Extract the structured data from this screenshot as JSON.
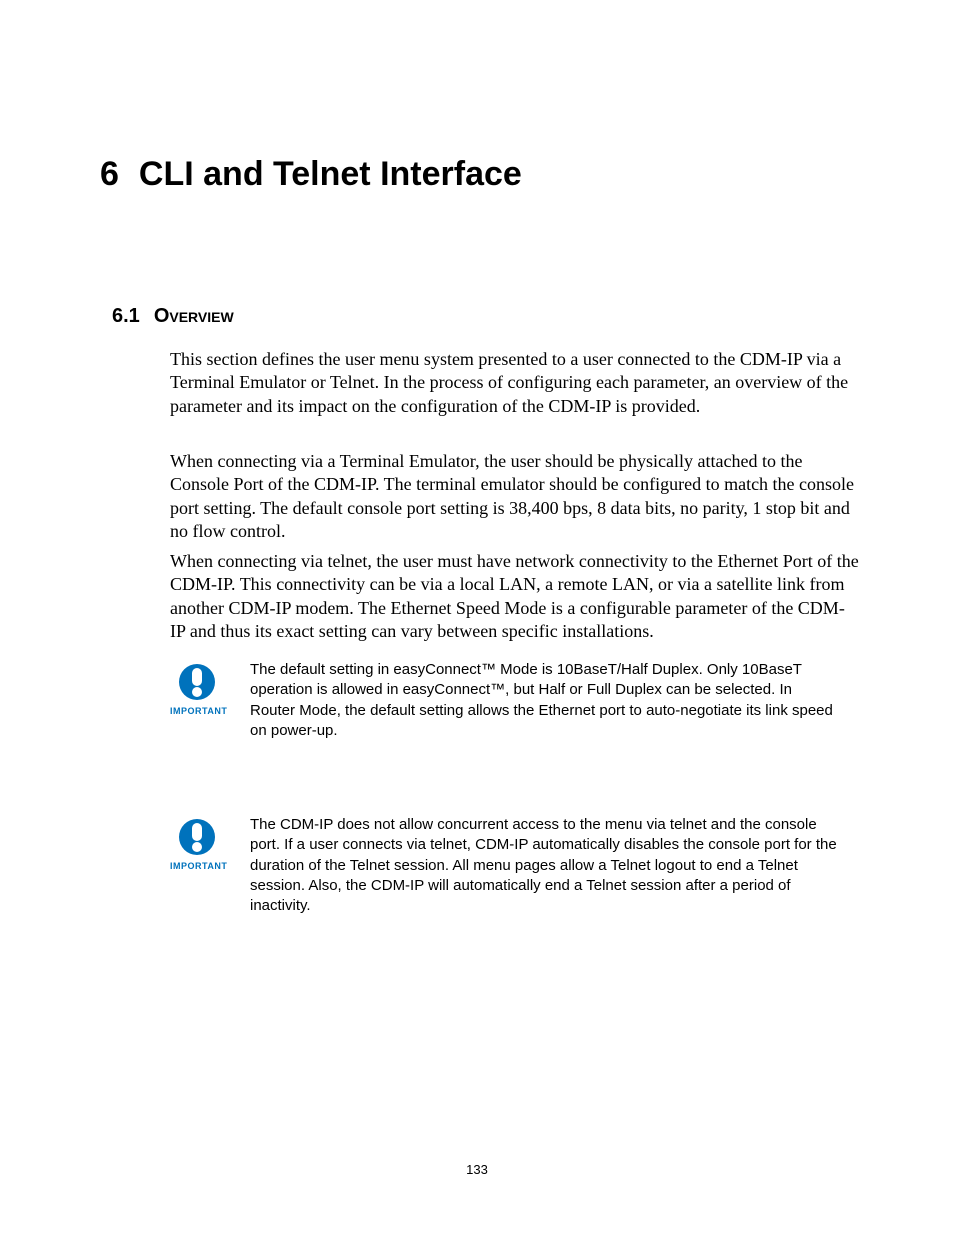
{
  "chapter": {
    "number": "6",
    "title": "CLI and Telnet Interface"
  },
  "section": {
    "number": "6.1",
    "title": "Overview"
  },
  "paragraphs": {
    "p1": "This section defines the user menu system presented to a user connected to the CDM-IP via a Terminal Emulator or Telnet. In the process of configuring each parameter, an overview of the parameter and its impact on the configuration of the CDM-IP is provided.",
    "p2": "When connecting via a Terminal Emulator, the user should be physically attached to the Console Port of the CDM-IP. The terminal emulator should be configured to match the console port setting. The default console port setting is 38,400 bps, 8 data bits, no parity, 1 stop bit and no flow control.",
    "p3": "When connecting via telnet, the user must have network connectivity to the Ethernet Port of the CDM-IP. This connectivity can be via a local LAN, a remote LAN, or via a satellite link from another CDM-IP modem. The Ethernet Speed Mode is a configurable parameter of the CDM-IP and thus its exact setting can vary between specific installations."
  },
  "important": {
    "label": "IMPORTANT",
    "note1": "The default setting in easyConnect™ Mode is 10BaseT/Half Duplex. Only 10BaseT operation is allowed in easyConnect™, but Half or Full Duplex can be selected. In Router Mode, the default setting allows the Ethernet port to auto-negotiate its link speed on power-up.",
    "note2": "The CDM-IP does not allow concurrent access to the menu via telnet and the console port. If a user connects via telnet, CDM-IP automatically disables the console port for the duration of the Telnet session. All menu pages allow a Telnet logout to end a Telnet session. Also, the CDM-IP will automatically end a Telnet session after a period of inactivity."
  },
  "page_number": "133",
  "colors": {
    "brand_blue": "#0072bc"
  }
}
